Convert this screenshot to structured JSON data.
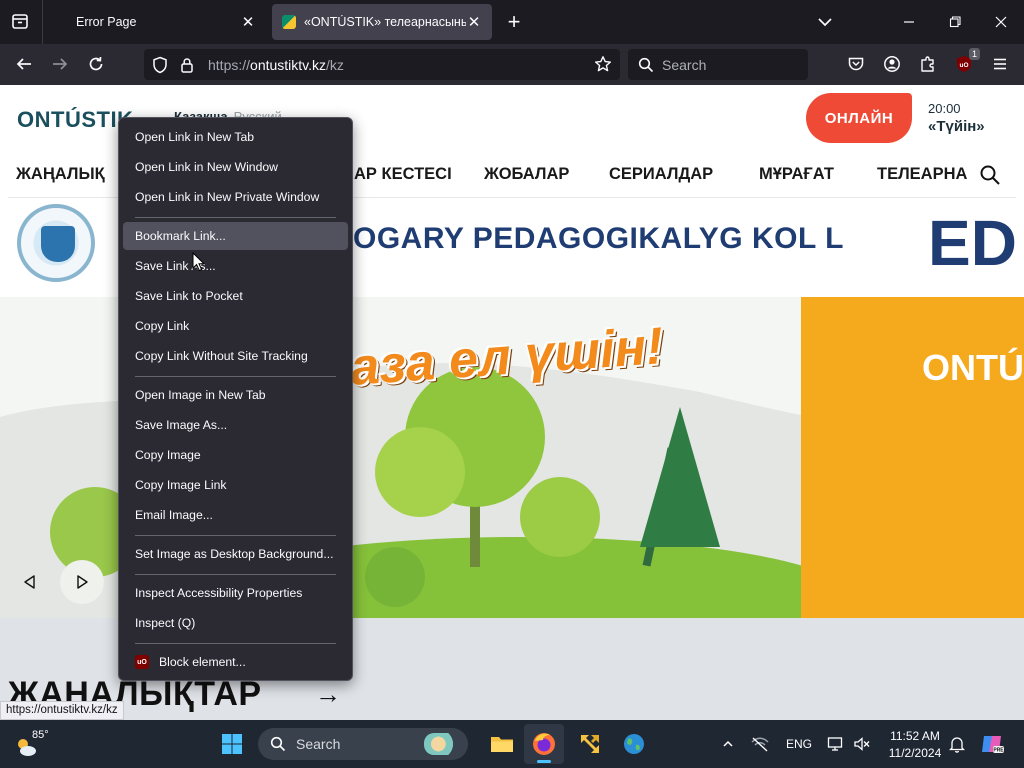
{
  "browser": {
    "tabs": [
      {
        "title": "Error Page",
        "active": false
      },
      {
        "title": "«ONTÚSTIK» телеарнасының р",
        "active": true
      }
    ],
    "url": {
      "prefix": "https://",
      "host": "ontustiktv.kz",
      "path": "/kz"
    },
    "search_placeholder": "Search",
    "extension_badge": "1",
    "icons": {
      "tab_manager": "tab-manager-icon",
      "new_tab": "plus-icon",
      "list_all_tabs": "chevron-down-icon",
      "back": "back-arrow-icon",
      "forward": "forward-arrow-icon",
      "reload": "reload-icon",
      "shield": "tracking-protection-shield-icon",
      "lock": "lock-icon",
      "bookmark_star": "star-icon",
      "pocket": "pocket-icon",
      "account": "account-icon",
      "extensions": "puzzle-icon",
      "ublock": "ublock-origin-icon",
      "menu": "hamburger-menu-icon"
    }
  },
  "site": {
    "logo": "ONTÚSTIK",
    "lang_active": "Казақша",
    "lang_other": "Русский",
    "live_button": "ОНЛАЙН",
    "live_time": "20:00",
    "live_show": "«Түйін»",
    "nav": [
      "ЖАҢАЛЫҚ",
      "АР КЕСТЕСІ",
      "ЖОБАЛАР",
      "СЕРИАЛДАР",
      "МҰРАҒАТ",
      "ТЕЛЕАРНА"
    ],
    "banner_text": "OGARY PEDAGOGIKALYG KOL L",
    "banner_big": "ED",
    "slide_headline": "аза ел үшін!",
    "slide_orange_text": "ONTÚ",
    "news_heading": "ЖАҢАЛЫҚТАР"
  },
  "status_url": "https://ontustiktv.kz/kz",
  "context_menu": {
    "groups": [
      [
        {
          "label": "Open Link in New Tab"
        },
        {
          "label": "Open Link in New Window"
        },
        {
          "label": "Open Link in New Private Window"
        }
      ],
      [
        {
          "label": "Bookmark Link...",
          "highlighted": true
        },
        {
          "label": "Save Link As..."
        },
        {
          "label": "Save Link to Pocket"
        },
        {
          "label": "Copy Link"
        },
        {
          "label": "Copy Link Without Site Tracking"
        }
      ],
      [
        {
          "label": "Open Image in New Tab"
        },
        {
          "label": "Save Image As..."
        },
        {
          "label": "Copy Image"
        },
        {
          "label": "Copy Image Link"
        },
        {
          "label": "Email Image..."
        }
      ],
      [
        {
          "label": "Set Image as Desktop Background..."
        }
      ],
      [
        {
          "label": "Inspect Accessibility Properties"
        },
        {
          "label": "Inspect (Q)"
        }
      ],
      [
        {
          "label": "Block element...",
          "icon": "ublock-origin-icon"
        }
      ]
    ]
  },
  "taskbar": {
    "weather_temp": "85°",
    "search_label": "Search",
    "tray_lang": "ENG",
    "time": "11:52 AM",
    "date": "11/2/2024"
  }
}
